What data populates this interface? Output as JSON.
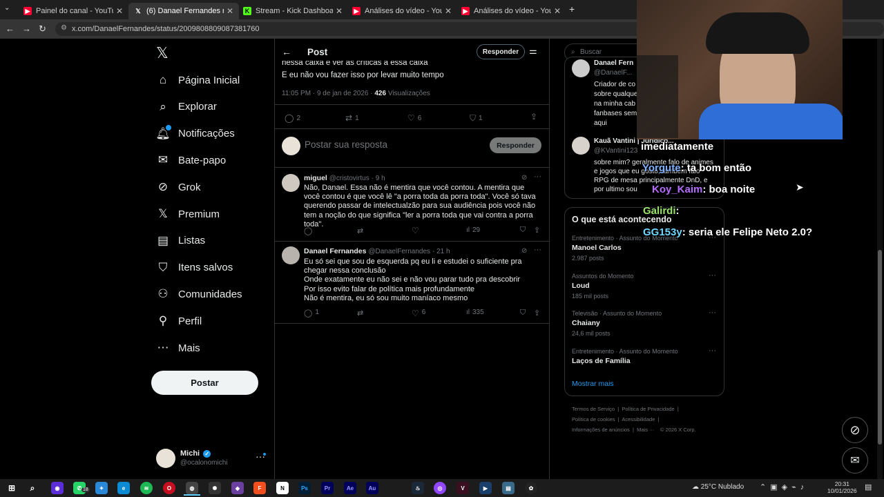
{
  "browser": {
    "tabs": [
      {
        "label": "Painel do canal - YouTube Studi",
        "icon": "youtube-icon"
      },
      {
        "label": "(6) Danael Fernandes no X: \"@c",
        "icon": "x-icon"
      },
      {
        "label": "Stream - Kick Dashboard",
        "icon": "kick-icon"
      },
      {
        "label": "Análises do vídeo - YouTube Stu",
        "icon": "youtube-icon"
      },
      {
        "label": "Análises do vídeo - YouTube Stu",
        "icon": "youtube-icon"
      }
    ],
    "url": "x.com/DanaelFernandes/status/2009808809087381760"
  },
  "nav": {
    "items": [
      {
        "label": "Página Inicial",
        "icon": "home-icon"
      },
      {
        "label": "Explorar",
        "icon": "search-icon"
      },
      {
        "label": "Notificações",
        "icon": "bell-icon"
      },
      {
        "label": "Bate-papo",
        "icon": "mail-icon"
      },
      {
        "label": "Grok",
        "icon": "grok-icon"
      },
      {
        "label": "Premium",
        "icon": "x-icon"
      },
      {
        "label": "Listas",
        "icon": "list-icon"
      },
      {
        "label": "Itens salvos",
        "icon": "bookmark-icon"
      },
      {
        "label": "Comunidades",
        "icon": "people-icon"
      },
      {
        "label": "Perfil",
        "icon": "person-icon"
      },
      {
        "label": "Mais",
        "icon": "more-icon"
      }
    ],
    "post_button": "Postar",
    "user": {
      "name": "Michi",
      "handle": "@ocalonomichi"
    }
  },
  "post": {
    "header_title": "Post",
    "reply_button": "Responder",
    "text_line1": "nessa caixa e ver as críticas a essa caixa",
    "text_line2": "E eu não vou fazer isso por levar muito tempo",
    "timestamp": "11:05 PM · 9 de jan de 2026 · ",
    "views_count": "426",
    "views_label": " Visualizações",
    "stats": {
      "replies": "2",
      "reposts": "1",
      "likes": "6",
      "bookmarks": "1"
    },
    "reply_placeholder": "Postar sua resposta",
    "reply_submit": "Responder"
  },
  "replies": [
    {
      "name": "miguel",
      "handle": "@cristovirtus",
      "time": "· 9 h",
      "text": "Não, Danael. Essa não é mentira que você contou. A mentira que você contou é que você lê \"a porra toda da porra toda\". Você só tava querendo passar de intelectualzão para sua audiência pois você não tem a noção do que significa \"ler a porra toda que vai contra a porra toda\".",
      "views": "29"
    },
    {
      "name": "Danael Fernandes",
      "handle": "@DanaelFernandes",
      "time": "· 21 h",
      "lines": [
        "Eu só sei que sou de esquerda pq eu li e estudei o suficiente pra chegar nessa conclusão",
        "Onde exatamente eu não sei e não vou parar tudo pra descobrir",
        "Por isso evito falar de política mais profundamente",
        "Não é mentira, eu só sou muito maníaco mesmo"
      ],
      "replies": "1",
      "likes": "6",
      "views": "335"
    }
  ],
  "sidebar": {
    "search_placeholder": "Buscar",
    "who1": {
      "name": "Danael Fern",
      "handle": "@DanaelF...",
      "bio": [
        "Criador de co",
        "sobre qualque",
        "na minha cab",
        "fanbases sem",
        "aqui"
      ]
    },
    "who2": {
      "name": "Kauã Vantini | Jurídico...",
      "handle": "@KVantini123",
      "bio": [
        "sobre mim? geralmente falo de animes",
        "e jogos que eu gosto, tambem falo",
        "RPG de mesa principalmente DnD, e",
        "por ultimo sou"
      ]
    },
    "trending_title": "O que está acontecendo",
    "trends": [
      {
        "meta": "Entretenimento · Assunto do Momento",
        "name": "Manoel Carlos",
        "count": "2.987 posts"
      },
      {
        "meta": "Assuntos do Momento",
        "name": "Loud",
        "count": "185 mil posts"
      },
      {
        "meta": "Televisão · Assunto do Momento",
        "name": "Chaiany",
        "count": "24,6 mil posts"
      },
      {
        "meta": "Entretenimento · Assunto do Momento",
        "name": "Laços de Família",
        "count": ""
      }
    ],
    "show_more": "Mostrar mais",
    "footer": [
      "Termos de Serviço",
      "Política de Privacidade",
      "Política de cookies",
      "Acessibilidade",
      "Informações de anúncios",
      "Mais ···",
      "© 2026 X Corp."
    ]
  },
  "stream_chat": [
    {
      "user": "imediatamente",
      "msg": "",
      "color": "#ffffff"
    },
    {
      "user": "Yorgute",
      "msg": ": ta bom então",
      "color": "#7fb0ff"
    },
    {
      "user": "Koy_Kaim",
      "msg": ": boa noite",
      "color": "#b56cff"
    },
    {
      "user": "Galirdi",
      "msg": ":",
      "color": "#9be36a"
    },
    {
      "user": "GG153y",
      "msg": ": seria ele Felipe Neto 2.0?",
      "color": "#6fd6ff"
    }
  ],
  "taskbar": {
    "weather": "25°C  Nublado",
    "time": "20:31",
    "date": "10/01/2026",
    "badge": "18"
  }
}
